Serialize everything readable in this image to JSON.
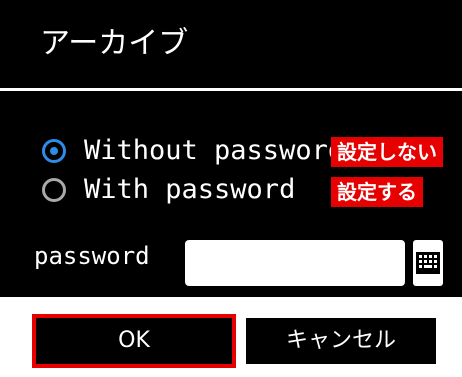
{
  "dialog": {
    "title": "アーカイブ",
    "options": [
      {
        "label": "Without password",
        "annotation": "設定しない",
        "selected": true
      },
      {
        "label": "With password",
        "annotation": "設定する",
        "selected": false
      }
    ],
    "password": {
      "label": "password",
      "value": "",
      "placeholder": ""
    },
    "keyboard_icon": "keyboard-icon",
    "buttons": {
      "ok": "OK",
      "cancel": "キャンセル"
    },
    "colors": {
      "selected_radio": "#2e8be6",
      "highlight": "#e60000",
      "background": "#000000"
    }
  }
}
